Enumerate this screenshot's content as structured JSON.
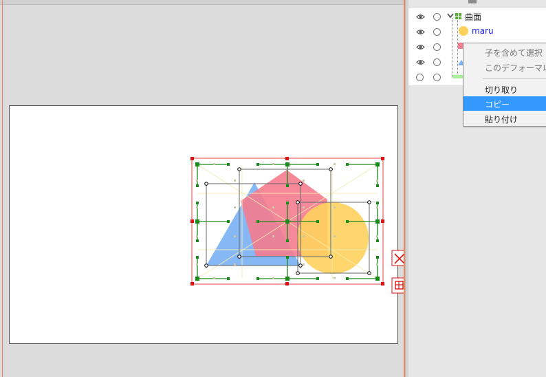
{
  "layers": {
    "group_name": "曲面",
    "child_name": "maru"
  },
  "context_menu": {
    "items": [
      {
        "label": "子を含めて選択",
        "enabled": false
      },
      {
        "label": "このデフォーマ以下を",
        "enabled": false
      },
      {
        "label": "切り取り",
        "enabled": true
      },
      {
        "label": "コピー",
        "enabled": true,
        "highlighted": true
      },
      {
        "label": "貼り付け",
        "enabled": true
      }
    ]
  },
  "colors": {
    "accent_orange": "#e8865a",
    "highlight": "#3399ff",
    "link_text": "#1a1aff",
    "shape_blue": "#7ab0f5",
    "shape_pink": "#f47c8e",
    "shape_yellow": "#ffd25e",
    "handle_red": "#e01010",
    "handle_green": "#1a8a1a"
  },
  "icons": {
    "eye": "eye-icon",
    "visibility_toggle": "circle-toggle-icon",
    "expand": "chevron-down-icon",
    "deformer_group": "grid-deformer-icon",
    "close": "close-icon",
    "pin": "pin-icon"
  }
}
